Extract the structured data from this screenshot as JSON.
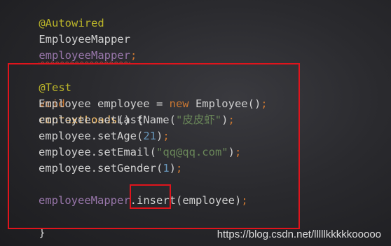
{
  "code": {
    "line1": {
      "annotation": "@Autowired"
    },
    "line2": {
      "type": "EmployeeMapper",
      "field": "employeeMapper",
      "end": ";"
    },
    "line4": {
      "annotation": "@Test"
    },
    "line5": {
      "keyword": "void",
      "method": "contextLoads",
      "rest": "() {"
    },
    "line6": {
      "type": "Employee employee = ",
      "keyword": "new",
      "rest": " Employee()",
      "end": ";"
    },
    "line7": {
      "prefix": "employee.setLastName(",
      "string": "\"皮皮虾\"",
      "suffix": ")",
      "end": ";"
    },
    "line8": {
      "prefix": "employee.setAge(",
      "number": "21",
      "suffix": ")",
      "end": ";"
    },
    "line9": {
      "prefix": "employee.setEmail(",
      "string": "\"qq@qq.com\"",
      "suffix": ")",
      "end": ";"
    },
    "line10": {
      "prefix": "employee.setGender(",
      "number": "1",
      "suffix": ")",
      "end": ";"
    },
    "line12": {
      "field": "employeeMapper",
      "dot": ".",
      "method": "insert",
      "rest": "(employee)",
      "end": ";"
    },
    "line13": {
      "brace": "}"
    }
  },
  "watermark": "https://blog.csdn.net/lllllkkkkkooooo",
  "colors": {
    "highlight_box": "#e0141c",
    "keyword": "#cc7832",
    "annotation": "#bbb529",
    "field": "#9876aa",
    "string": "#6a8759",
    "number": "#6897bb",
    "method": "#ffc66d"
  }
}
